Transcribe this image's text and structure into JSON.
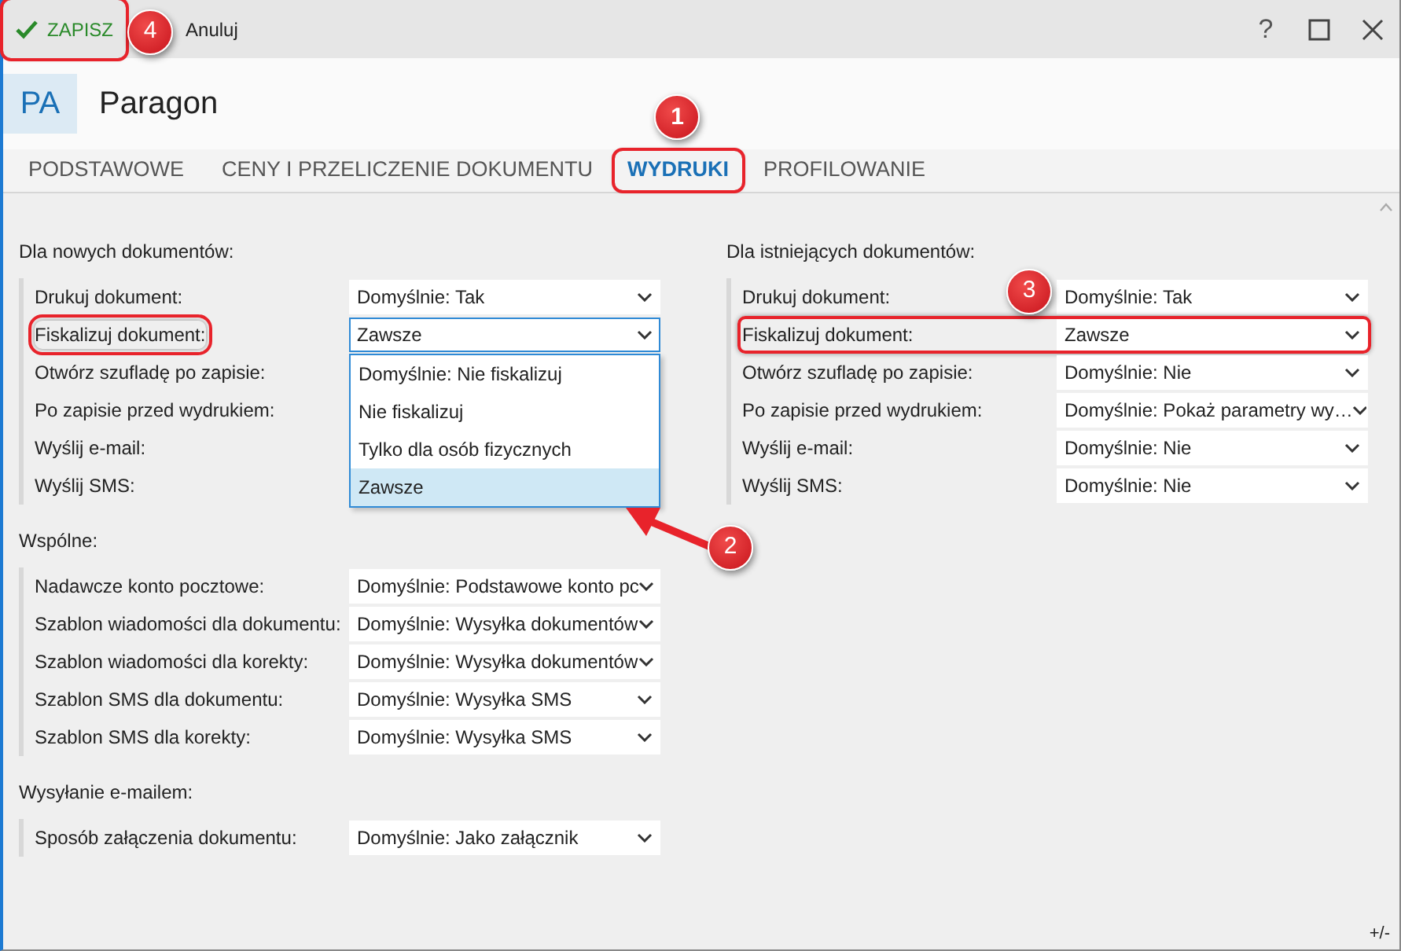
{
  "toolbar": {
    "save": {
      "label": "ZAPISZ",
      "highlighted": true,
      "callout": "4"
    },
    "cancel": {
      "label": "Anuluj"
    }
  },
  "window_controls": {
    "help": "?"
  },
  "header": {
    "badge": "PA",
    "title": "Paragon"
  },
  "tabs": [
    {
      "label": "PODSTAWOWE",
      "selected": false
    },
    {
      "label": "CENY I PRZELICZENIE DOKUMENTU",
      "selected": false
    },
    {
      "label": "WYDRUKI",
      "selected": true,
      "highlighted": true,
      "callout": "1"
    },
    {
      "label": "PROFILOWANIE",
      "selected": false
    }
  ],
  "columns": [
    {
      "sections": [
        {
          "title": "Dla nowych dokumentów:",
          "rows": [
            {
              "label": "Drukuj dokument:",
              "value": "Domyślnie: Tak"
            },
            {
              "label": "Fiskalizuj dokument:",
              "value": "Zawsze",
              "highlighted_label": true,
              "expanded": true,
              "options": [
                {
                  "label": "Domyślnie: Nie fiskalizuj",
                  "selected": false
                },
                {
                  "label": "Nie fiskalizuj",
                  "selected": false
                },
                {
                  "label": "Tylko dla osób fizycznych",
                  "selected": false
                },
                {
                  "label": "Zawsze",
                  "selected": true,
                  "callout": "2"
                }
              ]
            },
            {
              "label": "Otwórz szufladę po zapisie:"
            },
            {
              "label": "Po zapisie przed wydrukiem:"
            },
            {
              "label": "Wyślij e-mail:"
            },
            {
              "label": "Wyślij SMS:"
            }
          ]
        },
        {
          "title": "Wspólne:",
          "rows": [
            {
              "label": "Nadawcze konto pocztowe:",
              "value": "Domyślnie: Podstawowe konto pc"
            },
            {
              "label": "Szablon wiadomości dla dokumentu:",
              "value": "Domyślnie: Wysyłka dokumentów"
            },
            {
              "label": "Szablon wiadomości dla korekty:",
              "value": "Domyślnie: Wysyłka dokumentów"
            },
            {
              "label": "Szablon SMS dla dokumentu:",
              "value": "Domyślnie: Wysyłka SMS"
            },
            {
              "label": "Szablon SMS dla korekty:",
              "value": "Domyślnie: Wysyłka SMS"
            }
          ]
        },
        {
          "title": "Wysyłanie e-mailem:",
          "rows": [
            {
              "label": "Sposób załączenia dokumentu:",
              "value": "Domyślnie: Jako załącznik"
            }
          ]
        }
      ]
    },
    {
      "sections": [
        {
          "title": "Dla istniejących dokumentów:",
          "rows": [
            {
              "label": "Drukuj dokument:",
              "value": "Domyślnie: Tak"
            },
            {
              "label": "Fiskalizuj dokument:",
              "value": "Zawsze",
              "highlighted_row": true,
              "callout": "3"
            },
            {
              "label": "Otwórz szufladę po zapisie:",
              "value": "Domyślnie: Nie"
            },
            {
              "label": "Po zapisie przed wydrukiem:",
              "value": "Domyślnie: Pokaż parametry wy…"
            },
            {
              "label": "Wyślij e-mail:",
              "value": "Domyślnie: Nie"
            },
            {
              "label": "Wyślij SMS:",
              "value": "Domyślnie: Nie"
            }
          ]
        }
      ]
    }
  ],
  "footer": {
    "toggle": "+/-"
  }
}
